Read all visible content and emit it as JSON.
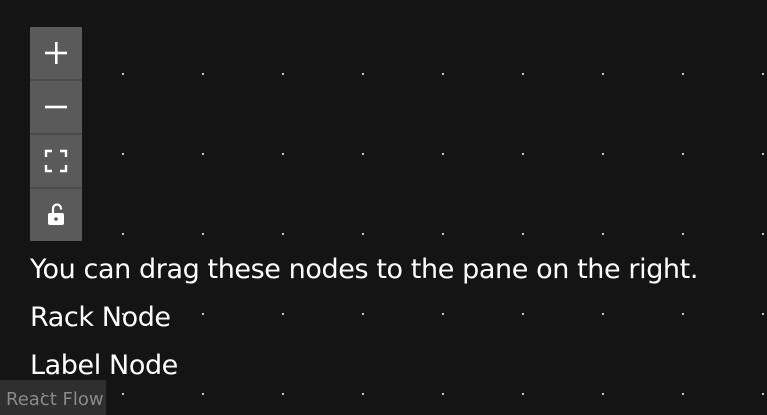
{
  "controls": {
    "zoom_in_icon": "plus-icon",
    "zoom_out_icon": "minus-icon",
    "fit_view_icon": "fit-view-icon",
    "lock_icon": "unlock-icon",
    "button_color": "#5a5a5a",
    "icon_color": "#ffffff"
  },
  "sidebar": {
    "description": "You can drag these nodes to the pane on the right.",
    "nodes": [
      {
        "label": "Rack Node"
      },
      {
        "label": "Label Node"
      }
    ]
  },
  "attribution": {
    "label": "React Flow"
  },
  "canvas": {
    "background_color": "#141414",
    "dot_color": "#d8d8d8"
  }
}
